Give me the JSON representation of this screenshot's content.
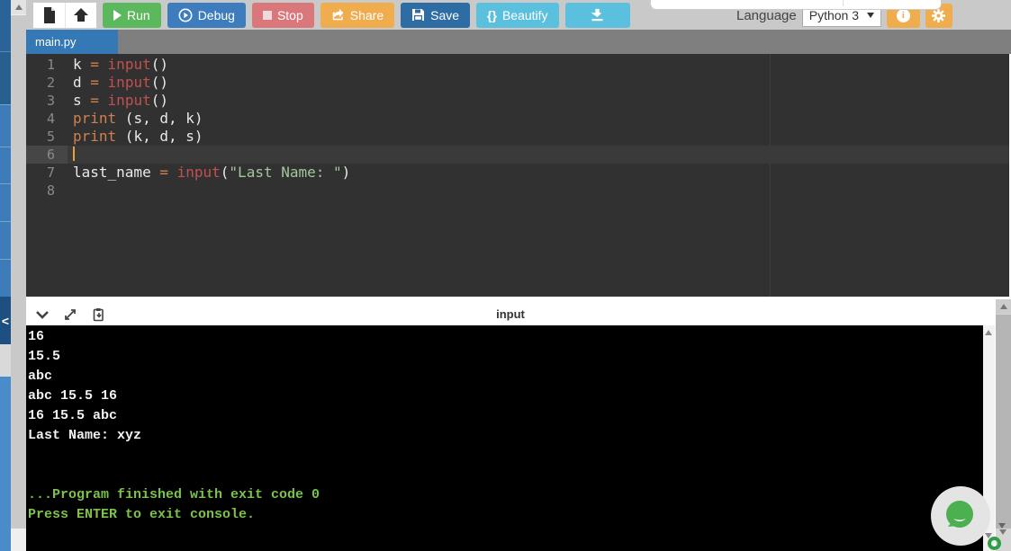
{
  "side_panel": {
    "collapse_glyph": "<"
  },
  "toolbar": {
    "buttons": [
      {
        "id": "run",
        "label": "Run",
        "color": "#5cb85c"
      },
      {
        "id": "debug",
        "label": "Debug",
        "color": "#3e7dbd"
      },
      {
        "id": "stop",
        "label": "Stop",
        "color": "#d9777b"
      },
      {
        "id": "share",
        "label": "Share",
        "color": "#f0ad4e"
      },
      {
        "id": "save",
        "label": "Save",
        "color": "#2e6da4"
      },
      {
        "id": "beautify",
        "label": "Beautify",
        "icon_text": "{}",
        "color": "#5bc0de"
      },
      {
        "id": "download",
        "label": "",
        "color": "#5bc0de"
      }
    ],
    "icons": {
      "info": "i"
    }
  },
  "language": {
    "label": "Language",
    "selected": "Python 3"
  },
  "tab": {
    "filename": "main.py"
  },
  "editor": {
    "active_line": 6,
    "gutter": [
      "1",
      "2",
      "3",
      "4",
      "5",
      "6",
      "7",
      "8"
    ],
    "lines": [
      [
        [
          "id",
          "k "
        ],
        [
          "op",
          "="
        ],
        [
          "pl",
          " "
        ],
        [
          "fn",
          "input"
        ],
        [
          "pl",
          "()"
        ]
      ],
      [
        [
          "id",
          "d "
        ],
        [
          "op",
          "="
        ],
        [
          "pl",
          " "
        ],
        [
          "fn",
          "input"
        ],
        [
          "pl",
          "()"
        ]
      ],
      [
        [
          "id",
          "s "
        ],
        [
          "op",
          "="
        ],
        [
          "pl",
          " "
        ],
        [
          "fn",
          "input"
        ],
        [
          "pl",
          "()"
        ]
      ],
      [
        [
          "kw",
          "print"
        ],
        [
          "pl",
          " (s, d, k)"
        ]
      ],
      [
        [
          "kw",
          "print"
        ],
        [
          "pl",
          " (k, d, s)"
        ]
      ],
      [],
      [
        [
          "id",
          "last_name "
        ],
        [
          "op",
          "="
        ],
        [
          "pl",
          " "
        ],
        [
          "fn",
          "input"
        ],
        [
          "pl",
          "("
        ],
        [
          "str",
          "\"Last Name: \""
        ],
        [
          "pl",
          ")"
        ]
      ],
      []
    ],
    "colors": {
      "background": "#313131",
      "plain": "#e9e9e9",
      "keyword_operator": "#d08050",
      "function": "#c25050",
      "string": "#a2c79c",
      "gutter_text": "#8a8a8a",
      "active_line": "#3a3a3a",
      "cursor": "#e2a33c"
    }
  },
  "console": {
    "title": "input",
    "lines": [
      {
        "cls": "out",
        "text": "16"
      },
      {
        "cls": "out",
        "text": "15.5"
      },
      {
        "cls": "out",
        "text": "abc"
      },
      {
        "cls": "out",
        "text": "abc 15.5 16"
      },
      {
        "cls": "out",
        "text": "16 15.5 abc"
      },
      {
        "cls": "out",
        "text": "Last Name: xyz"
      },
      {
        "cls": "out",
        "text": ""
      },
      {
        "cls": "out",
        "text": ""
      },
      {
        "cls": "ok",
        "text": "...Program finished with exit code 0"
      },
      {
        "cls": "ok",
        "text": "Press ENTER to exit console."
      }
    ],
    "colors": {
      "background": "#000000",
      "text": "#f2f2f2",
      "success": "#7dc24b"
    }
  }
}
